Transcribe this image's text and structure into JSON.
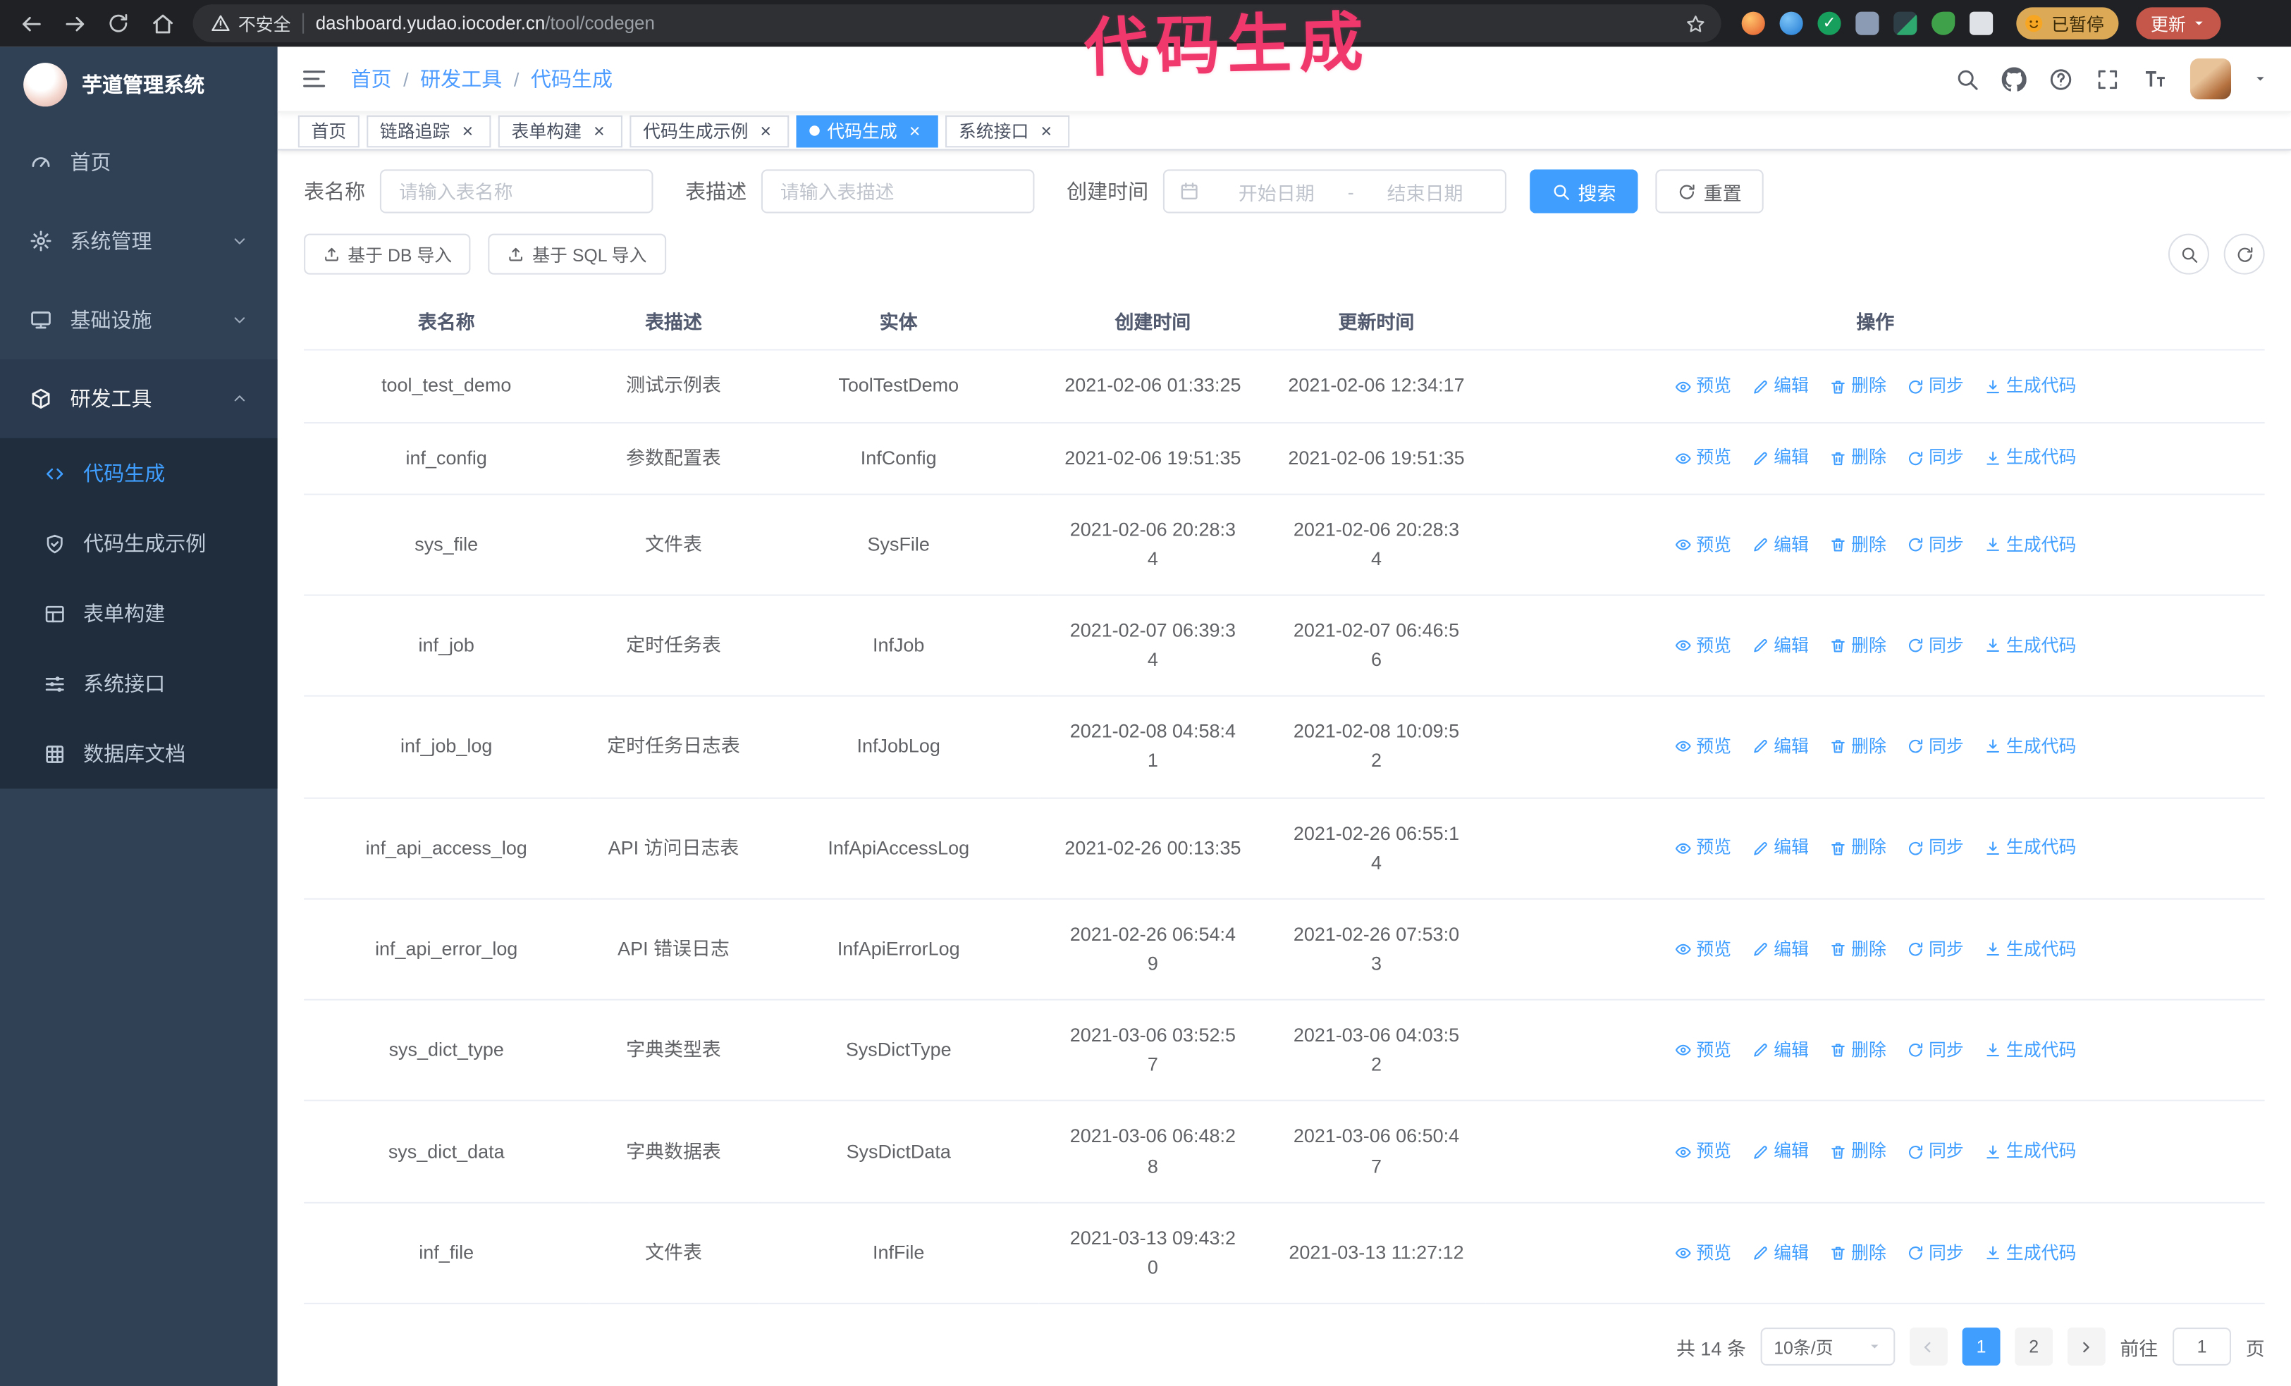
{
  "colors": {
    "accent": "#409eff",
    "sidebar": "#304156",
    "annotation": "#f0386d"
  },
  "browser": {
    "security_label": "不安全",
    "url_host": "dashboard.yudao.iocoder.cn",
    "url_path": "/tool/codegen",
    "extension_icons": [
      "fox-icon",
      "drop-icon",
      "verified-icon",
      "people-icon",
      "container-icon",
      "leaf-icon",
      "puzzle-icon"
    ],
    "paused_badge": "已暂停",
    "update_button": "更新"
  },
  "annotation": {
    "text": "代码生成"
  },
  "sidebar": {
    "logo_title": "芋道管理系统",
    "items": [
      {
        "label": "首页",
        "icon": "icon-gauge"
      },
      {
        "label": "系统管理",
        "icon": "icon-gear",
        "expandable": true
      },
      {
        "label": "基础设施",
        "icon": "icon-monitor",
        "expandable": true
      },
      {
        "label": "研发工具",
        "icon": "icon-cube",
        "expandable": true,
        "expanded": true
      }
    ],
    "submenu": [
      {
        "label": "代码生成",
        "icon": "icon-code",
        "active": true
      },
      {
        "label": "代码生成示例",
        "icon": "icon-shield"
      },
      {
        "label": "表单构建",
        "icon": "icon-table"
      },
      {
        "label": "系统接口",
        "icon": "icon-sliders"
      },
      {
        "label": "数据库文档",
        "icon": "icon-grid"
      }
    ]
  },
  "header": {
    "breadcrumb": [
      "首页",
      "研发工具",
      "代码生成"
    ]
  },
  "tabs": [
    {
      "label": "首页"
    },
    {
      "label": "链路追踪",
      "closable": true
    },
    {
      "label": "表单构建",
      "closable": true
    },
    {
      "label": "代码生成示例",
      "closable": true
    },
    {
      "label": "代码生成",
      "closable": true,
      "active": true
    },
    {
      "label": "系统接口",
      "closable": true
    }
  ],
  "filters": {
    "table_name_label": "表名称",
    "table_name_placeholder": "请输入表名称",
    "table_desc_label": "表描述",
    "table_desc_placeholder": "请输入表描述",
    "create_time_label": "创建时间",
    "date_start_placeholder": "开始日期",
    "date_separator": "-",
    "date_end_placeholder": "结束日期",
    "search_button": "搜索",
    "reset_button": "重置"
  },
  "toolbar": {
    "import_db_button": "基于 DB 导入",
    "import_sql_button": "基于 SQL 导入"
  },
  "table": {
    "columns": [
      "表名称",
      "表描述",
      "实体",
      "创建时间",
      "更新时间",
      "操作"
    ],
    "actions": [
      "预览",
      "编辑",
      "删除",
      "同步",
      "生成代码"
    ],
    "rows": [
      {
        "name": "tool_test_demo",
        "desc": "测试示例表",
        "entity": "ToolTestDemo",
        "created": "2021-02-06 01:33:25",
        "updated": "2021-02-06 12:34:17"
      },
      {
        "name": "inf_config",
        "desc": "参数配置表",
        "entity": "InfConfig",
        "created": "2021-02-06 19:51:35",
        "updated": "2021-02-06 19:51:35"
      },
      {
        "name": "sys_file",
        "desc": "文件表",
        "entity": "SysFile",
        "created": "2021-02-06 20:28:3\n4",
        "updated": "2021-02-06 20:28:3\n4"
      },
      {
        "name": "inf_job",
        "desc": "定时任务表",
        "entity": "InfJob",
        "created": "2021-02-07 06:39:3\n4",
        "updated": "2021-02-07 06:46:5\n6"
      },
      {
        "name": "inf_job_log",
        "desc": "定时任务日志表",
        "entity": "InfJobLog",
        "created": "2021-02-08 04:58:4\n1",
        "updated": "2021-02-08 10:09:5\n2"
      },
      {
        "name": "inf_api_access_log",
        "desc": "API 访问日志表",
        "entity": "InfApiAccessLog",
        "created": "2021-02-26 00:13:35",
        "updated": "2021-02-26 06:55:1\n4"
      },
      {
        "name": "inf_api_error_log",
        "desc": "API 错误日志",
        "entity": "InfApiErrorLog",
        "created": "2021-02-26 06:54:4\n9",
        "updated": "2021-02-26 07:53:0\n3"
      },
      {
        "name": "sys_dict_type",
        "desc": "字典类型表",
        "entity": "SysDictType",
        "created": "2021-03-06 03:52:5\n7",
        "updated": "2021-03-06 04:03:5\n2"
      },
      {
        "name": "sys_dict_data",
        "desc": "字典数据表",
        "entity": "SysDictData",
        "created": "2021-03-06 06:48:2\n8",
        "updated": "2021-03-06 06:50:4\n7"
      },
      {
        "name": "inf_file",
        "desc": "文件表",
        "entity": "InfFile",
        "created": "2021-03-13 09:43:2\n0",
        "updated": "2021-03-13 11:27:12"
      }
    ]
  },
  "pagination": {
    "total": "共 14 条",
    "page_size": "10条/页",
    "pages": [
      {
        "label": "1",
        "active": true
      },
      {
        "label": "2"
      }
    ],
    "goto_prefix": "前往",
    "goto_value": "1",
    "goto_suffix": "页"
  }
}
